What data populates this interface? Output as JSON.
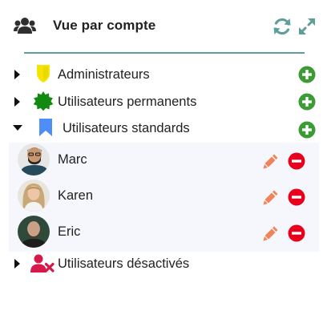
{
  "header": {
    "title": "Vue par compte",
    "icon": "users-icon",
    "actions": [
      "sync-icon",
      "expand-icon"
    ]
  },
  "colors": {
    "accent": "#5f9e99",
    "add": "#3d9b35",
    "edit": "#f0835a",
    "delete": "#e8001d",
    "admin": "#f5e400",
    "permanent": "#128a12",
    "standard": "#4f8ef7",
    "disabled": "#d6184a"
  },
  "groups": [
    {
      "label": "Administrateurs",
      "icon": "shield-icon",
      "expanded": false
    },
    {
      "label": "Utilisateurs permanents",
      "icon": "badge-icon",
      "expanded": false
    },
    {
      "label": "Utilisateurs standards",
      "icon": "bookmark-icon",
      "expanded": true
    },
    {
      "label": "Utilisateurs désactivés",
      "icon": "user-disabled-icon",
      "expanded": false
    }
  ],
  "users": [
    {
      "name": "Marc"
    },
    {
      "name": "Karen"
    },
    {
      "name": "Eric"
    }
  ]
}
